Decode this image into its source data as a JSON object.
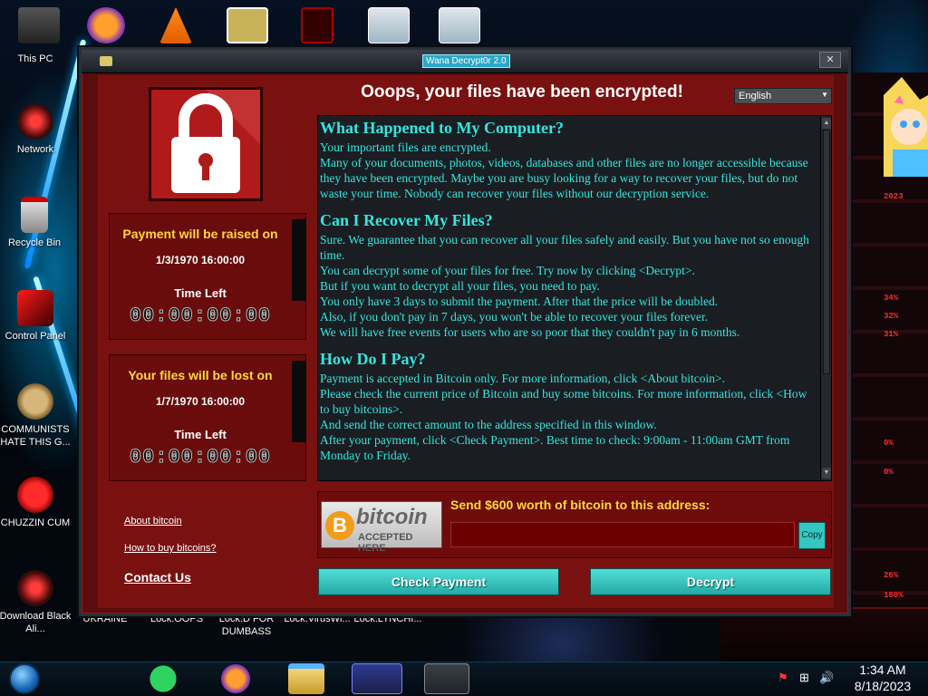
{
  "window": {
    "title": "Wana Decrypt0r 2.0",
    "close_glyph": "✕",
    "heading": "Ooops, your files have been encrypted!",
    "language": "English"
  },
  "payment_raised": {
    "title": "Payment will be raised on",
    "date": "1/3/1970 16:00:00",
    "time_left_label": "Time Left",
    "countdown": "00:00:00:00"
  },
  "files_lost": {
    "title": "Your files will be lost on",
    "date": "1/7/1970 16:00:00",
    "time_left_label": "Time Left",
    "countdown": "00:00:00:00"
  },
  "links": {
    "about_bitcoin": "About bitcoin",
    "how_to_buy": "How to buy bitcoins?",
    "contact_us": "Contact Us"
  },
  "message": {
    "sections": [
      {
        "heading": "What Happened to My Computer?",
        "paragraphs": [
          "Your important files are encrypted.",
          "Many of your documents, photos, videos, databases and other files are no longer accessible because they have been encrypted. Maybe you are busy looking for a way to recover your files, but do not waste your time. Nobody can recover your files without our decryption service."
        ]
      },
      {
        "heading": "Can I Recover My Files?",
        "paragraphs": [
          "Sure. We guarantee that you can recover all your files safely and easily. But you have not so enough time.",
          "You can decrypt some of your files for free. Try now by clicking <Decrypt>.",
          "But if you want to decrypt all your files, you need to pay.",
          "You only have 3 days to submit the payment. After that the price will be doubled.",
          "Also, if you don't pay in 7 days, you won't be able to recover your files forever.",
          "We will have free events for users who are so poor that they couldn't pay in 6 months."
        ]
      },
      {
        "heading": "How Do I Pay?",
        "paragraphs": [
          "Payment is accepted in Bitcoin only. For more information, click <About bitcoin>.",
          "Please check the current price of Bitcoin and buy some bitcoins. For more information, click <How to buy bitcoins>.",
          "And send the correct amount to the address specified in this window.",
          "After your payment, click <Check Payment>. Best time to check: 9:00am - 11:00am GMT from Monday to Friday."
        ]
      }
    ]
  },
  "bitcoin": {
    "logo_word": "bitcoin",
    "logo_sub": "ACCEPTED HERE",
    "coin_glyph": "B",
    "send_label": "Send $600 worth of bitcoin to this address:",
    "address_value": "",
    "copy_label": "Copy"
  },
  "buttons": {
    "check_payment": "Check Payment",
    "decrypt": "Decrypt"
  },
  "desktop_icons": [
    {
      "label": "This PC"
    },
    {
      "label": "Network"
    },
    {
      "label": "Recycle Bin"
    },
    {
      "label": "Control Panel"
    },
    {
      "label": "COMMUNISTS HATE THIS G..."
    },
    {
      "label": "CHUZZIN CUM"
    },
    {
      "label": "Download Black Ali..."
    }
  ],
  "bottom_files": [
    {
      "label": "UKRAINE"
    },
    {
      "label": "Lock.OOPS"
    },
    {
      "label": "Lock.D FOR DUMBASS"
    },
    {
      "label": "Lock.VirusWi..."
    },
    {
      "label": "Lock.LYNCHI..."
    }
  ],
  "taskbar": {
    "time": "1:34 AM",
    "date": "8/18/2023",
    "volume_glyph": "🔊"
  },
  "colors": {
    "window_bg": "#7a1111",
    "accent_yellow": "#ffd83a",
    "message_text": "#33e6e0",
    "button_teal": "#22a9a3"
  }
}
